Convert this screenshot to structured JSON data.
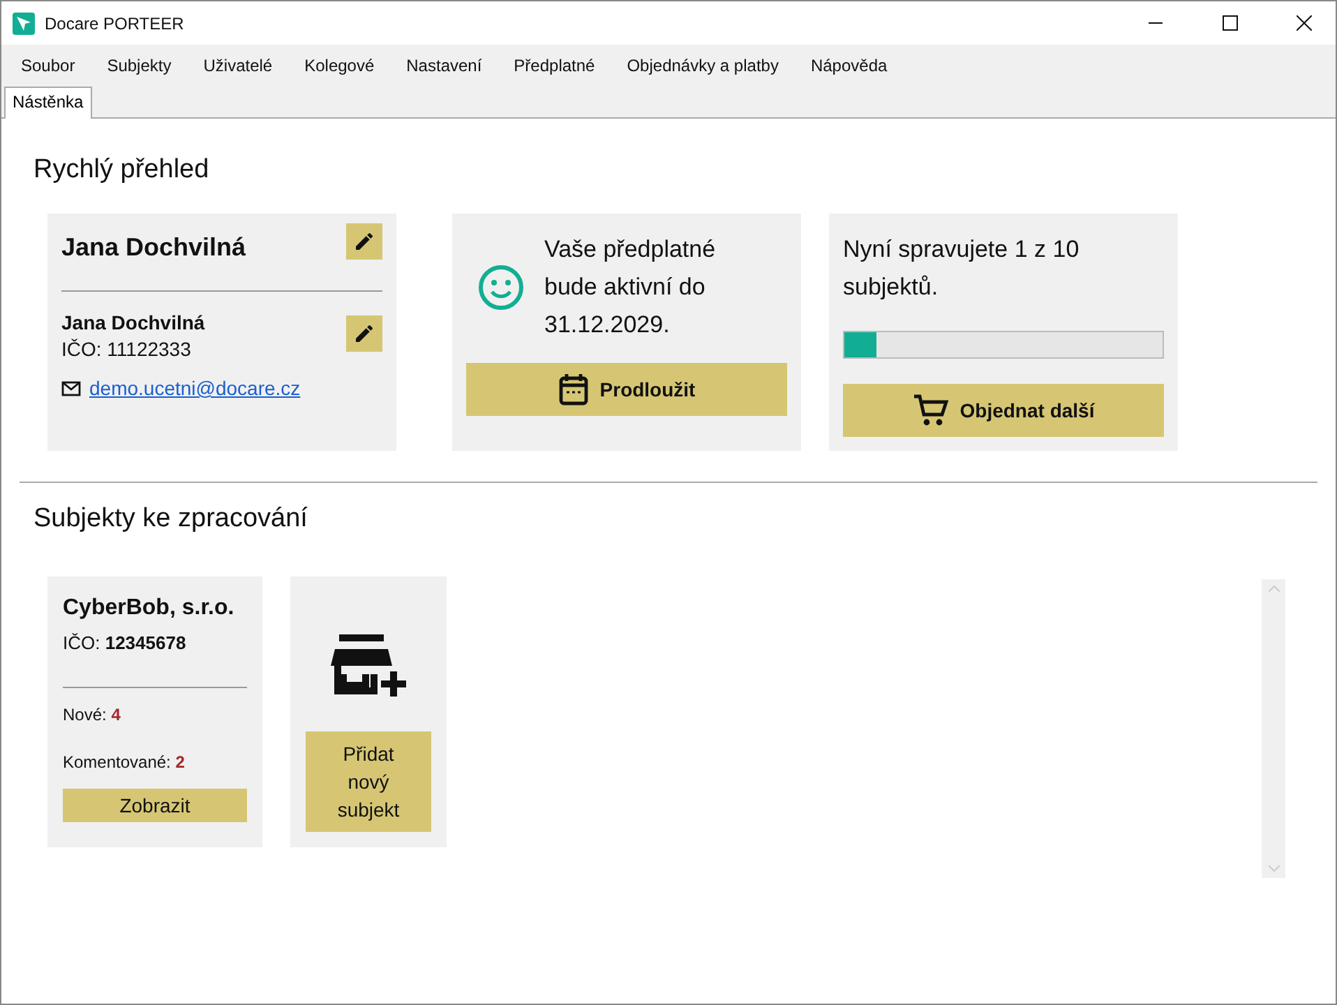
{
  "window": {
    "title": "Docare PORTEER"
  },
  "menu": [
    "Soubor",
    "Subjekty",
    "Uživatelé",
    "Kolegové",
    "Nastavení",
    "Předplatné",
    "Objednávky a platby",
    "Nápověda"
  ],
  "tabs": [
    {
      "label": "Nástěnka",
      "selected": true
    }
  ],
  "overview": {
    "heading": "Rychlý přehled",
    "user_card": {
      "name": "Jana Dochvilná",
      "subject_name": "Jana Dochvilná",
      "ico": "IČO: 11122333",
      "email": "demo.ucetni@docare.cz"
    },
    "subscription_card": {
      "text": "Vaše předplatné bude aktivní do 31.12.2029.",
      "button": "Prodloužit"
    },
    "usage_card": {
      "text": "Nyní spravujete 1 z 10 subjektů.",
      "level": 0.1,
      "button": "Objednat další"
    }
  },
  "subjects": {
    "heading": "Subjekty ke zpracování",
    "items": [
      {
        "kind": "subject",
        "name": "CyberBob, s.r.o.",
        "ico": "IČO: **12345678**",
        "new": "Nové: **4**",
        "commented": "Komentované: **2**",
        "button": "Zobrazit"
      },
      {
        "kind": "add",
        "button": "Přidat nový subjekt"
      }
    ]
  }
}
